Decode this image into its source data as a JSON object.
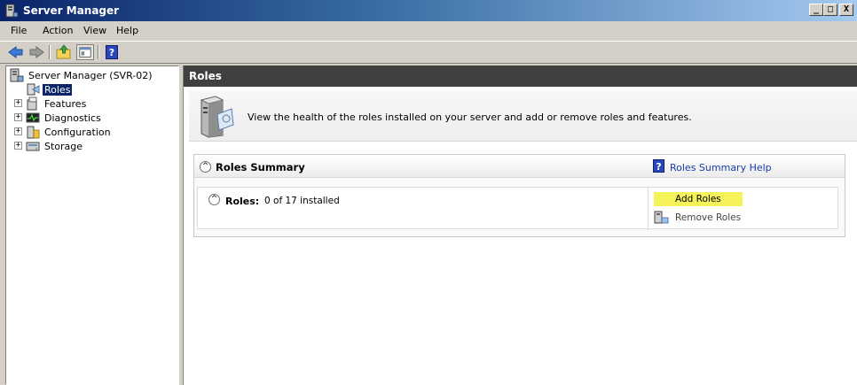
{
  "window": {
    "title": "Server Manager",
    "controls": {
      "minimize": "_",
      "maximize": "□",
      "close": "X"
    }
  },
  "menu": [
    "File",
    "Action",
    "View",
    "Help"
  ],
  "toolbar": {
    "buttons": [
      "back-arrow-icon",
      "forward-arrow-icon",
      "up-folder-icon",
      "show-hide-console-tree-icon",
      "help-icon"
    ],
    "help_glyph": "?"
  },
  "tree": {
    "root": "Server Manager (SVR-02)",
    "items": [
      {
        "label": "Roles",
        "selected": true,
        "expander": ""
      },
      {
        "label": "Features",
        "selected": false,
        "expander": "+"
      },
      {
        "label": "Diagnostics",
        "selected": false,
        "expander": "+"
      },
      {
        "label": "Configuration",
        "selected": false,
        "expander": "+"
      },
      {
        "label": "Storage",
        "selected": false,
        "expander": "+"
      }
    ]
  },
  "content": {
    "header": "Roles",
    "intro": "View the health of the roles installed on your server and add or remove roles and features.",
    "summary": {
      "title": "Roles Summary",
      "collapse_glyph": "^",
      "help_link": "Roles Summary Help",
      "help_glyph": "?",
      "roles_label": "Roles:",
      "roles_count": "0 of 17 installed",
      "tasks": [
        {
          "label": "Add Roles",
          "highlighted": true
        },
        {
          "label": "Remove Roles",
          "highlighted": false
        }
      ]
    }
  },
  "colors": {
    "titlebar_start": "#0a246a",
    "content_header": "#404040",
    "selection": "#0a246a",
    "link": "#1a3aa8",
    "highlight": "#f6f25a"
  }
}
